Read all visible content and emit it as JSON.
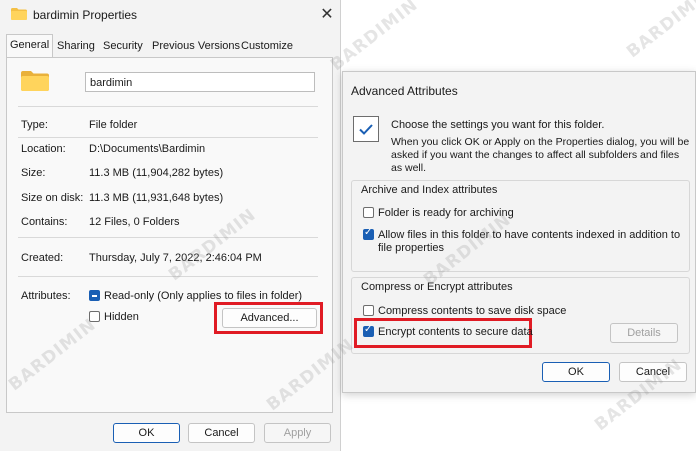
{
  "properties": {
    "title": "bardimin Properties",
    "tabs": [
      "General",
      "Sharing",
      "Security",
      "Previous Versions",
      "Customize"
    ],
    "folder_name": "bardimin",
    "type_label": "Type:",
    "type_value": "File folder",
    "location_label": "Location:",
    "location_value": "D:\\Documents\\Bardimin",
    "size_label": "Size:",
    "size_value": "11.3 MB (11,904,282 bytes)",
    "size_disk_label": "Size on disk:",
    "size_disk_value": "11.3 MB (11,931,648 bytes)",
    "contains_label": "Contains:",
    "contains_value": "12 Files, 0 Folders",
    "created_label": "Created:",
    "created_value": "Thursday, July 7, 2022, 2:46:04 PM",
    "attributes_label": "Attributes:",
    "readonly_label": "Read-only (Only applies to files in folder)",
    "hidden_label": "Hidden",
    "advanced_button": "Advanced...",
    "ok_button": "OK",
    "cancel_button": "Cancel",
    "apply_button": "Apply"
  },
  "advanced": {
    "title": "Advanced Attributes",
    "intro": "Choose the settings you want for this folder.",
    "note": "When you click OK or Apply on the Properties dialog, you will be asked if you want the changes to affect all subfolders and files as well.",
    "archive_group": "Archive and Index attributes",
    "archiving_label": "Folder is ready for archiving",
    "indexed_label": "Allow files in this folder to have contents indexed in addition to file properties",
    "compress_group": "Compress or Encrypt attributes",
    "compress_label": "Compress contents to save disk space",
    "encrypt_label": "Encrypt contents to secure data",
    "details_button": "Details",
    "ok_button": "OK",
    "cancel_button": "Cancel"
  },
  "watermark": "BARDIMIN",
  "colors": {
    "accent": "#1a5fb4",
    "highlight": "#e01b24",
    "folder": "#f4c045"
  },
  "icons": {
    "folder": "folder-icon",
    "close": "close-icon",
    "check": "check-icon"
  }
}
